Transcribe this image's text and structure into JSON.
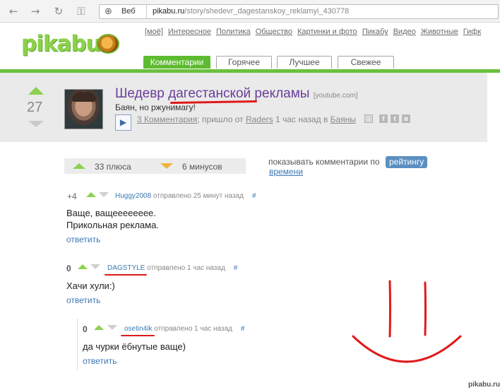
{
  "browser": {
    "back_icon": "←",
    "forward_icon": "→",
    "reload_icon": "↻",
    "key_icon": "⚿",
    "globe_icon": "⊕",
    "veb_label": "Веб",
    "url_host": "pikabu.ru",
    "url_path": "/story/shedevr_dagestanskoy_reklamyi_430778"
  },
  "site": {
    "logo": "pikabu",
    "topnav": [
      "[моё]",
      "Интересное",
      "Политика",
      "Общество",
      "Картинки и фото",
      "Пикабу",
      "Видео",
      "Животные",
      "Гифк"
    ],
    "tabs": [
      "Комментарии",
      "Горячее",
      "Лучшее",
      "Свежее"
    ],
    "colors": {
      "green": "#6ac13c",
      "title_purple": "#6a3d9a",
      "link_blue": "#3c78b4",
      "markup_red": "#e01a1a"
    }
  },
  "story": {
    "rating": "27",
    "title_start": "Шедевр ",
    "title_mid": "дагестанской",
    "title_end": " рекламы",
    "source": "[youtube.com]",
    "description": "Баян, но ржунимагу!",
    "play_icon": "▶",
    "comments_link": "3 Комментария",
    "meta_text": "; пришло от ",
    "author": "Raders",
    "time_text": " 1 час назад в ",
    "category": "Баяны",
    "share_icons": [
      "save-icon",
      "facebook-icon",
      "twitter-icon",
      "vkontakte-icon"
    ],
    "share_glyphs": [
      "▫",
      "f",
      "t",
      "в"
    ]
  },
  "stats": {
    "plus_label": "33 плюса",
    "minus_label": "6 минусов"
  },
  "sort": {
    "label": "показывать комментарии по",
    "active": "рейтингу",
    "other": "времени"
  },
  "comments": [
    {
      "score": "+4",
      "author": "Huggy2008",
      "meta": " отправлено 25 минут назад",
      "hash": "#",
      "lines": [
        "Ваще, ващееееееее.",
        "Прикольная реклама."
      ],
      "reply": "ответить"
    },
    {
      "score": "0",
      "author": "DAGSTYLE",
      "meta": " отправлено 1 час назад",
      "hash": "#",
      "lines": [
        "Хачи хули:)"
      ],
      "reply": "ответить"
    },
    {
      "score": "0",
      "author": "osetin4ik",
      "meta": " отправлено 1 час назад",
      "hash": "#",
      "lines": [
        "да чурки ёбнутые ваще)"
      ],
      "reply": "ответить"
    }
  ],
  "watermark": "pikabu.ru"
}
